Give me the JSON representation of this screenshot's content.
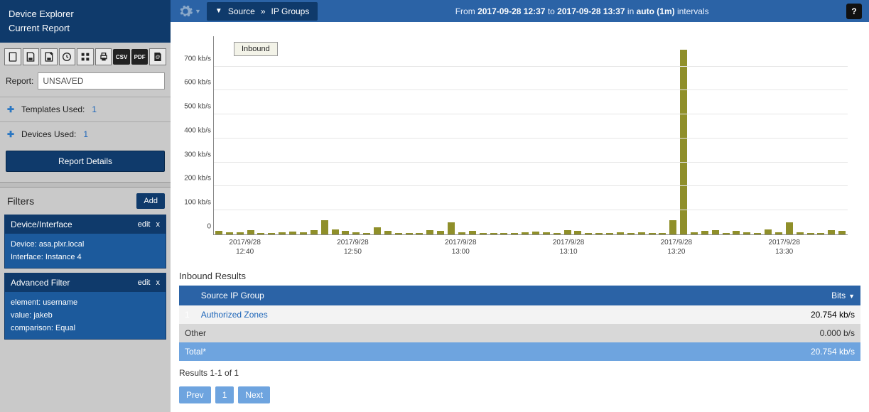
{
  "sidebar": {
    "title1": "Device Explorer",
    "title2": "Current Report",
    "report_label": "Report:",
    "report_value": "UNSAVED",
    "templates_label": "Templates Used:",
    "templates_count": "1",
    "devices_label": "Devices Used:",
    "devices_count": "1",
    "details_btn": "Report Details",
    "filters_label": "Filters",
    "add_btn": "Add",
    "filter1": {
      "title": "Device/Interface",
      "edit": "edit",
      "close": "x",
      "l1": "Device: asa.plxr.local",
      "l2": "Interface: Instance 4"
    },
    "filter2": {
      "title": "Advanced Filter",
      "edit": "edit",
      "close": "x",
      "l1": "element: username",
      "l2": "value: jakeb",
      "l3": "comparison: Equal"
    }
  },
  "topbar": {
    "crumb_source": "Source",
    "crumb_sep": "»",
    "crumb_ip": "IP Groups",
    "time_prefix": "From ",
    "time_from": "2017-09-28 12:37",
    "time_mid": " to ",
    "time_to": "2017-09-28 13:37",
    "time_suffix1": " in ",
    "time_interval": "auto (1m)",
    "time_suffix2": " intervals",
    "help": "?"
  },
  "chart_data": {
    "type": "bar",
    "legend": "Inbound",
    "y_unit": "kb/s",
    "y_ticks": [
      0,
      100,
      200,
      300,
      400,
      500,
      600,
      700
    ],
    "y_max": 770,
    "x_ticks": [
      {
        "pos": 5,
        "l1": "2017/9/28",
        "l2": "12:40"
      },
      {
        "pos": 22,
        "l1": "2017/9/28",
        "l2": "12:50"
      },
      {
        "pos": 39,
        "l1": "2017/9/28",
        "l2": "13:00"
      },
      {
        "pos": 56,
        "l1": "2017/9/28",
        "l2": "13:10"
      },
      {
        "pos": 73,
        "l1": "2017/9/28",
        "l2": "13:20"
      },
      {
        "pos": 90,
        "l1": "2017/9/28",
        "l2": "13:30"
      }
    ],
    "values": [
      15,
      10,
      8,
      18,
      5,
      6,
      10,
      12,
      10,
      18,
      60,
      20,
      15,
      8,
      6,
      30,
      15,
      6,
      5,
      6,
      18,
      15,
      50,
      8,
      15,
      6,
      6,
      5,
      6,
      8,
      12,
      8,
      6,
      18,
      15,
      6,
      5,
      5,
      8,
      6,
      10,
      6,
      5,
      60,
      770,
      8,
      15,
      18,
      6,
      15,
      10,
      6,
      20,
      10,
      50,
      8,
      6,
      5,
      18,
      15
    ]
  },
  "results": {
    "title": "Inbound Results",
    "col1": "Source IP Group",
    "col2": "Bits",
    "row_idx": "1",
    "row1_name": "Authorized Zones",
    "row1_val": "20.754 kb/s",
    "other_label": "Other",
    "other_val": "0.000 b/s",
    "total_label": "Total*",
    "total_val": "20.754 kb/s",
    "count": "Results 1-1 of 1",
    "prev": "Prev",
    "page": "1",
    "next": "Next"
  }
}
